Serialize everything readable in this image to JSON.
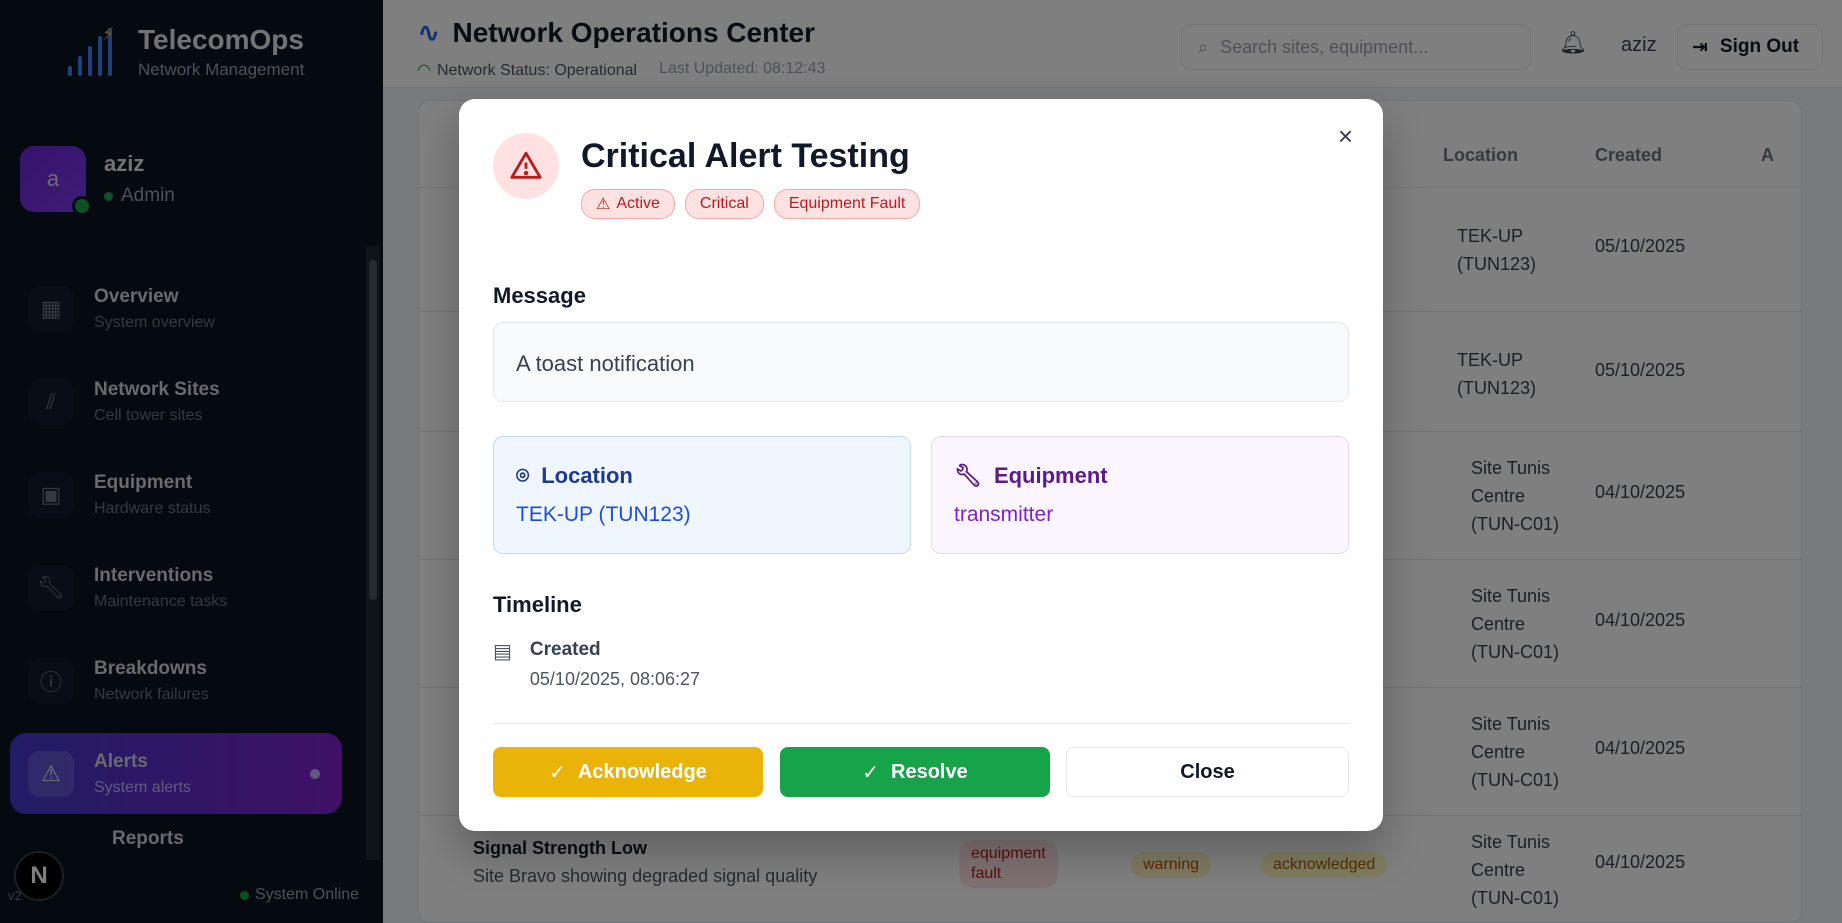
{
  "brand": {
    "title": "TelecomOps",
    "subtitle": "Network Management"
  },
  "user": {
    "initial": "a",
    "name": "aziz",
    "role": "Admin"
  },
  "nav": [
    {
      "label": "Overview",
      "sub": "System overview",
      "icon": "grid-icon"
    },
    {
      "label": "Network Sites",
      "sub": "Cell tower sites",
      "icon": "tower-icon"
    },
    {
      "label": "Equipment",
      "sub": "Hardware status",
      "icon": "chip-icon"
    },
    {
      "label": "Interventions",
      "sub": "Maintenance tasks",
      "icon": "wrench-icon"
    },
    {
      "label": "Breakdowns",
      "sub": "Network failures",
      "icon": "alert-circle-icon"
    },
    {
      "label": "Alerts",
      "sub": "System alerts",
      "icon": "warning-triangle-icon"
    },
    {
      "label": "Reports",
      "sub": "",
      "icon": "report-icon"
    }
  ],
  "sidebar_footer": {
    "version": "v2",
    "status": "System Online",
    "badge": "N"
  },
  "header": {
    "title": "Network Operations Center",
    "status": "Network Status: Operational",
    "updated": "Last Updated: 08:12:43",
    "search_placeholder": "Search sites, equipment...",
    "username": "aziz",
    "signout": "Sign Out"
  },
  "table": {
    "columns": [
      "Location",
      "Created",
      "A"
    ],
    "rows": [
      {
        "location": [
          "TEK-UP",
          "(TUN123)"
        ],
        "created": "05/10/2025"
      },
      {
        "location": [
          "TEK-UP",
          "(TUN123)"
        ],
        "created": "05/10/2025"
      },
      {
        "location": [
          "Site Tunis",
          "Centre",
          "(TUN-C01)"
        ],
        "created": "04/10/2025"
      },
      {
        "location": [
          "Site Tunis",
          "Centre",
          "(TUN-C01)"
        ],
        "created": "04/10/2025"
      },
      {
        "location": [
          "Site Tunis",
          "Centre",
          "(TUN-C01)"
        ],
        "created": "04/10/2025"
      }
    ],
    "last_row": {
      "title": "Signal Strength Low",
      "desc": "Site Bravo showing degraded signal quality",
      "type": [
        "equipment",
        "fault"
      ],
      "severity": "warning",
      "status": "acknowledged",
      "location": [
        "Site Tunis",
        "Centre",
        "(TUN-C01)"
      ],
      "created": "04/10/2025"
    }
  },
  "modal": {
    "title": "Critical Alert Testing",
    "badges": [
      "Active",
      "Critical",
      "Equipment Fault"
    ],
    "message_label": "Message",
    "message": "A toast notification",
    "location_label": "Location",
    "location_value": "TEK-UP (TUN123)",
    "equipment_label": "Equipment",
    "equipment_value": "transmitter",
    "timeline_label": "Timeline",
    "created_label": "Created",
    "created_value": "05/10/2025, 08:06:27",
    "buttons": {
      "acknowledge": "Acknowledge",
      "resolve": "Resolve",
      "close": "Close"
    },
    "close_glyph": "×"
  },
  "colors": {
    "accent": "#2563eb",
    "danger": "#b91c1c",
    "warning": "#eab308",
    "success": "#16a34a"
  }
}
